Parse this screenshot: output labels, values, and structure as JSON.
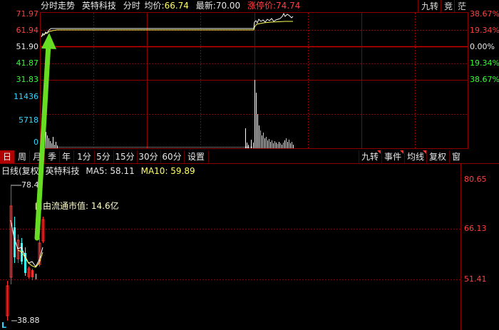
{
  "intraday": {
    "title": "分时走势",
    "stock_name": "英特科技",
    "mode": "分时",
    "avg_label": "均价:",
    "avg_value": "66.74",
    "latest_label": "最新:",
    "latest_value": "70.00",
    "limit_label": "涨停价:",
    "limit_value": "74.74",
    "right_buttons": [
      "九转",
      "竞",
      "茫"
    ],
    "price_axis": [
      "71.97",
      "61.94",
      "51.90",
      "41.87",
      "31.83"
    ],
    "pct_axis": [
      "38.67%",
      "19.34%",
      "0.00%",
      "19.34%",
      "38.67%"
    ],
    "volume_axis": [
      "11436",
      "5718",
      "0"
    ]
  },
  "tabs": [
    "日",
    "周",
    "月",
    "季",
    "年",
    "1分",
    "5分",
    "15分",
    "30分",
    "60分",
    "设置"
  ],
  "active_tab": "日",
  "right_tabs": [
    "九转",
    "事件",
    "均线",
    "复权",
    "窗"
  ],
  "kline": {
    "period_label": "日线(复权",
    "stock_name": "英特科技",
    "ma5_label": "MA5: 58.11",
    "ma10_label": "MA10: 59.89",
    "high_label": "78.4",
    "low_label": "38.88",
    "float_cap_label": "自由流通市值: 14.6亿",
    "right_axis": [
      "80.65",
      "66.13",
      "51.41"
    ],
    "bottom_marker": "L"
  },
  "colors": {
    "background": "#000000",
    "grid_red": "#8b0000",
    "up": "#ff3030",
    "down": "#00ffff",
    "arrow": "#66dd22",
    "active_tab": "#b00000"
  }
}
